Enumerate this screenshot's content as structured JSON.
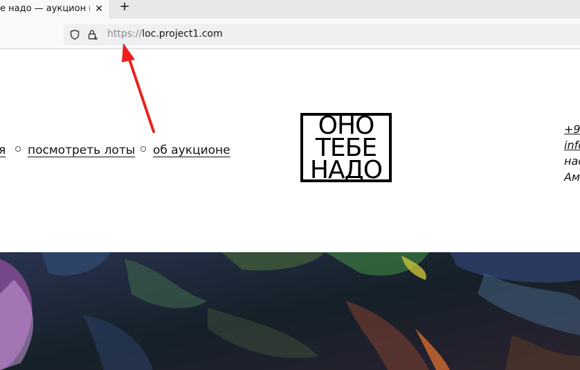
{
  "browser": {
    "tab_title": "е надо — аукцион в",
    "tab_close": "✕",
    "new_tab": "+",
    "url_scheme": "https://",
    "url_host": "loc.project1.com"
  },
  "nav": {
    "items": [
      {
        "label": "я"
      },
      {
        "label": "посмотреть лоты"
      },
      {
        "label": "об аукционе"
      }
    ]
  },
  "logo": {
    "lines": [
      "ОНО",
      "ТЕБЕ",
      "НАДО"
    ]
  },
  "contact": {
    "lines": [
      "+9",
      "info",
      "нас",
      "Ам"
    ]
  },
  "colors": {
    "annotation_arrow": "#e8211d",
    "banner_dark": "#1c2330"
  }
}
